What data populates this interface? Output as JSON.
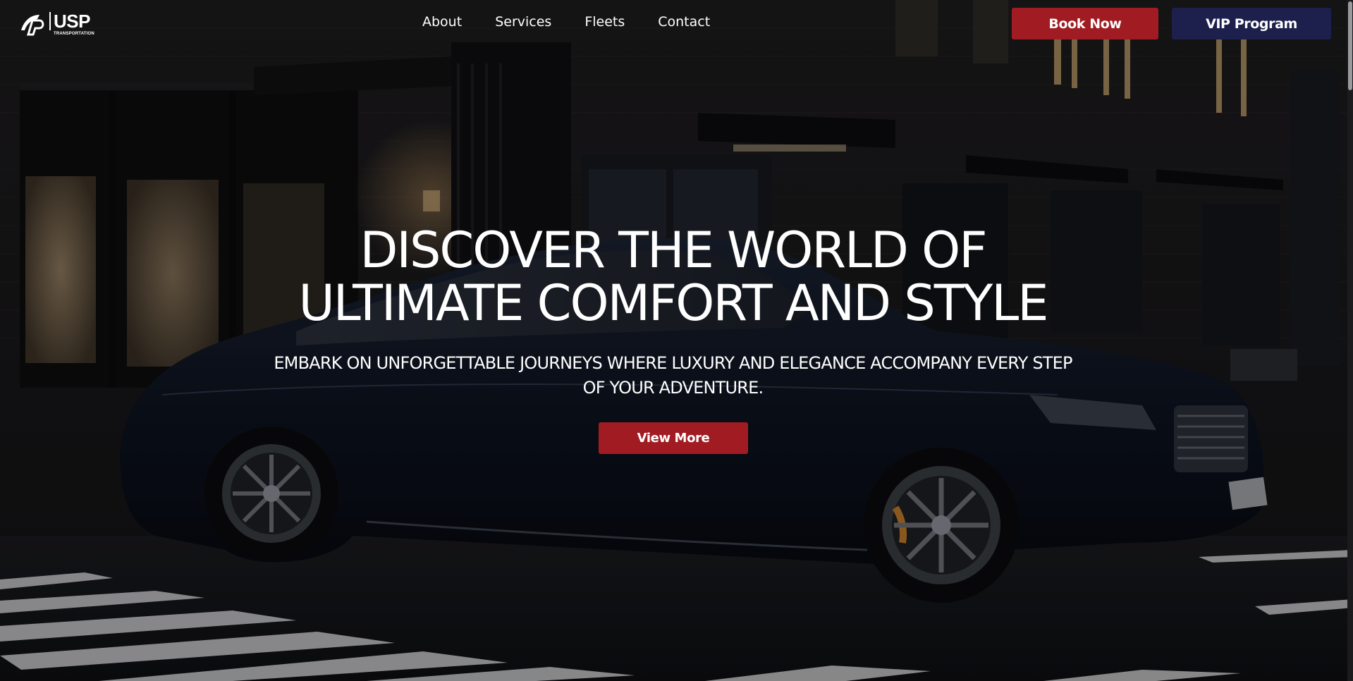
{
  "brand": {
    "name": "USP",
    "tagline": "TRANSPORTATION",
    "logo_icon": "usp-logo-mark"
  },
  "nav": {
    "items": [
      {
        "label": "About"
      },
      {
        "label": "Services"
      },
      {
        "label": "Fleets"
      },
      {
        "label": "Contact"
      }
    ]
  },
  "header_actions": {
    "book_label": "Book Now",
    "vip_label": "VIP Program"
  },
  "hero": {
    "title_line1": "DISCOVER THE WORLD OF",
    "title_line2": "ULTIMATE COMFORT AND STYLE",
    "subtitle": "EMBARK ON UNFORGETTABLE JOURNEYS WHERE LUXURY AND ELEGANCE ACCOMPANY EVERY STEP OF YOUR ADVENTURE.",
    "cta_label": "View More"
  },
  "colors": {
    "accent_red": "#a01c22",
    "accent_navy": "#1d1f4c",
    "text": "#ffffff"
  }
}
